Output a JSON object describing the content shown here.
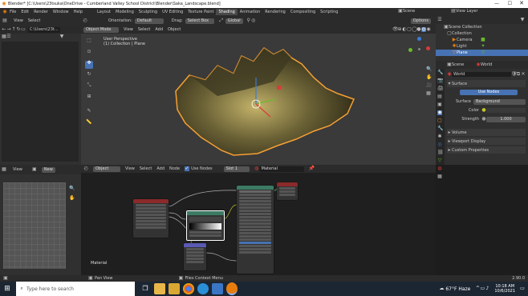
{
  "titlebar": {
    "title": "Blender* [C:\\Users\\23tsuka\\OneDrive - Cumberland Valley School District\\Blender\\Saka_Landscape.blend]"
  },
  "menu": {
    "items": [
      "File",
      "Edit",
      "Render",
      "Window",
      "Help"
    ]
  },
  "workspaces": [
    "Layout",
    "Modeling",
    "Sculpting",
    "UV Editing",
    "Texture Paint",
    "Shading",
    "Animation",
    "Rendering",
    "Compositing",
    "Scripting"
  ],
  "active_workspace": "Shading",
  "scene": {
    "label": "Scene",
    "view_layer": "View Layer"
  },
  "filebrowser": {
    "view": "View",
    "select": "Select",
    "path": "C:\\Users\\23t..."
  },
  "viewport": {
    "mode": "Object Mode",
    "menus": [
      "View",
      "Select",
      "Add",
      "Object"
    ],
    "orientation_label": "Orientation:",
    "orientation_value": "Default",
    "drag_label": "Drag:",
    "drag_value": "Select Box",
    "transform": "Global",
    "options": "Options",
    "overlay_title": "User Perspective",
    "overlay_subtitle": "(1) Collection | Plane"
  },
  "outliner": {
    "root": "Scene Collection",
    "items": [
      {
        "name": "Collection"
      },
      {
        "name": "Camera"
      },
      {
        "name": "Light"
      },
      {
        "name": "Plane"
      }
    ]
  },
  "properties": {
    "tab_scene": "Scene",
    "tab_world": "World",
    "world_name": "World",
    "surface": "Surface",
    "use_nodes": "Use Nodes",
    "surface_label": "Surface",
    "surface_value": "Background",
    "color_label": "Color",
    "strength_label": "Strength",
    "strength_value": "1.000",
    "sections": [
      "Volume",
      "Viewport Display",
      "Custom Properties"
    ]
  },
  "image_editor": {
    "view": "View",
    "new": "New"
  },
  "node_editor": {
    "object": "Object",
    "menus": [
      "View",
      "Select",
      "Add",
      "Node"
    ],
    "use_nodes": "Use Nodes",
    "slot": "Slot 1",
    "material": "Material",
    "label": "Material"
  },
  "statusbar": {
    "pan_view": "Pan View",
    "context_menu": "Files Context Menu",
    "version": "2.90.0"
  },
  "taskbar": {
    "search_placeholder": "Type here to search",
    "weather": "67°F Haze",
    "time": "10:18 AM",
    "date": "10/6/2021"
  },
  "colors": {
    "accent": "#4772b3",
    "active_orange": "#f5a035",
    "node_green": "#3c7a63",
    "node_red": "#8b2a2a",
    "node_blue": "#5a5ab4"
  }
}
